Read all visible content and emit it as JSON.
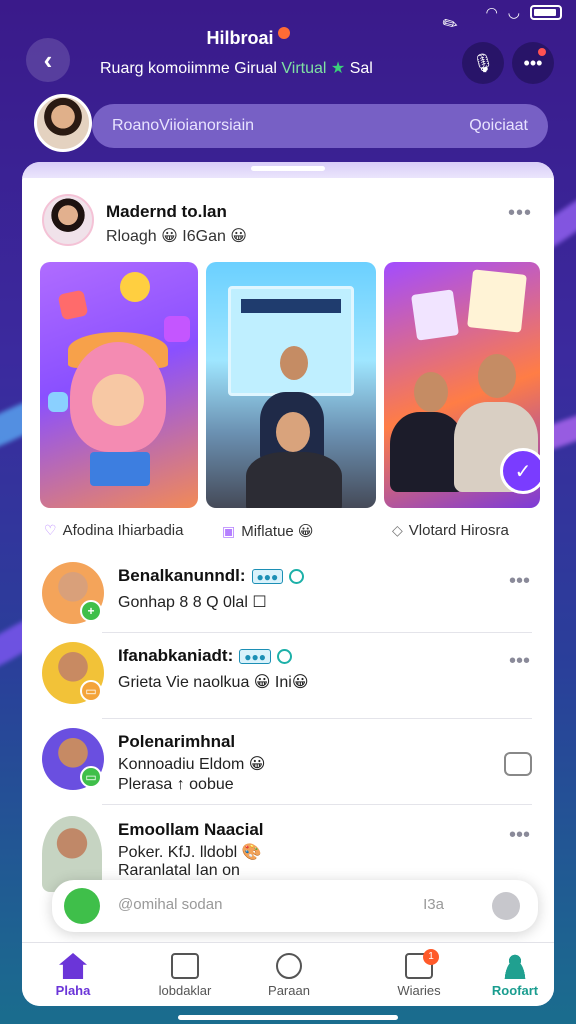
{
  "header": {
    "title": "Hilbroai",
    "subtitle_start": "Ruarg komoiimme Girual",
    "subtitle_green": "Virtual",
    "subtitle_end": "Sal"
  },
  "search": {
    "placeholder": "RoanoViioianorsiain",
    "action": "Qoiciaat"
  },
  "post": {
    "author": "Madernd to.lan",
    "meta": "Rloagh 😀 I6Gan 😀",
    "captions": [
      {
        "icon": "heart-outline-icon",
        "text": "Afodina Ihiarbadia"
      },
      {
        "icon": "calendar-icon",
        "text": "Miflatue 😀"
      },
      {
        "icon": "tag-icon",
        "text": "Vlotard Hirosra"
      }
    ]
  },
  "list": [
    {
      "name": "Benalkanunndl:",
      "line1": "Gonhap 8 8 Q 0lal ☐",
      "badge_color": "#3fbf4a",
      "avatar_color": "#f4a45a"
    },
    {
      "name": "Ifanabkaniadt:",
      "line1": "Grieta Vie naolkua 😀 Ini😀",
      "badge_color": "#f4a43a",
      "avatar_color": "#f2c238"
    },
    {
      "name": "Polenarimhnal",
      "line1": "Konnoadiu Eldom 😀",
      "line2": "Plerasa ↑ oobue",
      "badge_color": "#3fbf4a",
      "avatar_color": "#6a4fe0"
    },
    {
      "name": "Emoollam Naacial",
      "line1": "Poker. KfJ. lldobl 🎨",
      "line2": "Raranlatal Ian on",
      "avatar_color": "#c6d4c2"
    }
  ],
  "compose": {
    "placeholder": "@omihal sodan",
    "count": "I3a"
  },
  "nav": [
    {
      "icon": "home-icon",
      "label": "Plaha"
    },
    {
      "icon": "box-icon",
      "label": "lobdaklar"
    },
    {
      "icon": "compass-icon",
      "label": "Paraan"
    },
    {
      "icon": "messages-icon",
      "label": "Wiaries",
      "badge": "1"
    },
    {
      "icon": "person-icon",
      "label": "Roofart"
    }
  ]
}
